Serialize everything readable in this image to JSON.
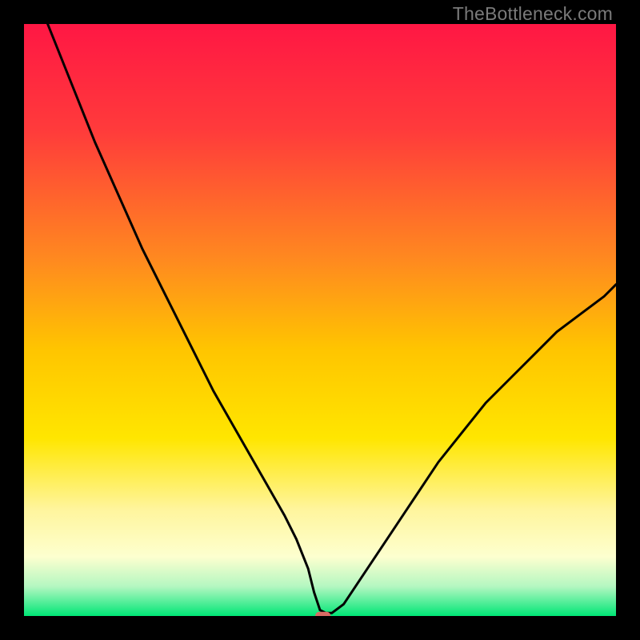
{
  "watermark": "TheBottleneck.com",
  "chart_data": {
    "type": "line",
    "title": "",
    "xlabel": "",
    "ylabel": "",
    "xlim": [
      0,
      100
    ],
    "ylim": [
      0,
      100
    ],
    "grid": false,
    "legend": false,
    "background_gradient": {
      "stops": [
        {
          "offset": 0,
          "color": "#ff1744"
        },
        {
          "offset": 18,
          "color": "#ff3b3b"
        },
        {
          "offset": 40,
          "color": "#ff8a1f"
        },
        {
          "offset": 55,
          "color": "#ffc500"
        },
        {
          "offset": 70,
          "color": "#ffe600"
        },
        {
          "offset": 82,
          "color": "#fff59d"
        },
        {
          "offset": 90,
          "color": "#fdffcf"
        },
        {
          "offset": 95,
          "color": "#b4f7c1"
        },
        {
          "offset": 100,
          "color": "#00e676"
        }
      ]
    },
    "series": [
      {
        "name": "bottleneck-curve",
        "x": [
          4,
          8,
          12,
          16,
          20,
          24,
          28,
          32,
          36,
          40,
          44,
          46,
          48,
          49,
          50,
          51,
          52,
          54,
          58,
          62,
          66,
          70,
          74,
          78,
          82,
          86,
          90,
          94,
          98,
          100
        ],
        "y": [
          100,
          90,
          80,
          71,
          62,
          54,
          46,
          38,
          31,
          24,
          17,
          13,
          8,
          4,
          1,
          0.5,
          0.5,
          2,
          8,
          14,
          20,
          26,
          31,
          36,
          40,
          44,
          48,
          51,
          54,
          56
        ]
      }
    ],
    "marker": {
      "name": "optimal-point",
      "x": 50.5,
      "y": 0,
      "color": "#d96b65",
      "width": 2.6,
      "height": 1.4
    }
  }
}
